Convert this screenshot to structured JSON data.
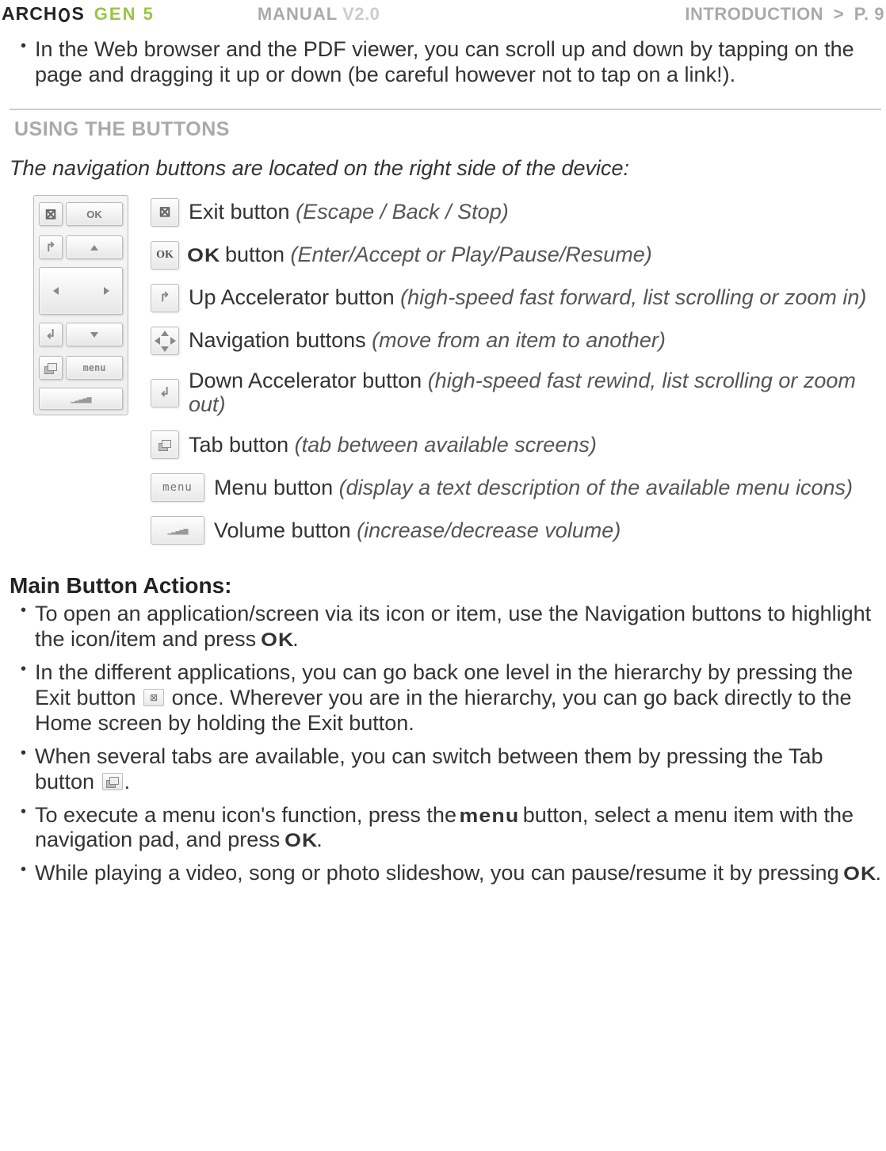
{
  "header": {
    "brand": "ARCHOS",
    "gen": "GEN 5",
    "manual_label": "MANUAL",
    "manual_version": "V2.0",
    "breadcrumb_section": "INTRODUCTION",
    "breadcrumb_sep": ">",
    "breadcrumb_page": "P. 9"
  },
  "top_bullets": [
    "In the Web browser and the PDF viewer, you can scroll up and down by tapping on the page and dragging it up or down (be careful however not to tap on a link!)."
  ],
  "section": {
    "title": "USING THE BUTTONS",
    "intro": "The navigation buttons are located on the right side of the device:"
  },
  "buttons": {
    "exit": {
      "label": "Exit button",
      "desc": "(Escape / Back / Stop)",
      "icon": "close-icon"
    },
    "ok": {
      "label_prefix_heavy": "OK",
      "label_suffix": " button",
      "desc": "(Enter/Accept or Play/Pause/Resume)",
      "icon_text": "OK",
      "icon": "ok-icon"
    },
    "up": {
      "label": "Up Accelerator button",
      "desc": "(high-speed fast forward, list scrolling or zoom in)",
      "icon": "accel-up-icon"
    },
    "nav": {
      "label": "Navigation buttons",
      "desc": "(move from an item to another)",
      "icon": "nav-cross-icon"
    },
    "down": {
      "label": "Down Accelerator button",
      "desc": "(high-speed fast rewind, list scrolling or zoom out)",
      "icon": "accel-down-icon"
    },
    "tab": {
      "label": "Tab button",
      "desc": "(tab between available screens)",
      "icon": "tab-icon"
    },
    "menu": {
      "label": "Menu button",
      "desc": "(display a text description of the available menu icons)",
      "icon_text": "menu",
      "icon": "menu-icon"
    },
    "vol": {
      "label": "Volume button",
      "desc": "(increase/decrease volume)",
      "icon": "volume-icon"
    }
  },
  "main_actions_heading": "Main Button Actions:",
  "main_actions": {
    "items": [
      {
        "pre": "To open an application/screen via its icon or item, use the Navigation buttons to highlight the icon/item and press ",
        "heavy": "OK",
        "post": "."
      },
      {
        "pre": "In the different applications, you can go back one level in the hierarchy by pressing the Exit button ",
        "inline_icon": "close-icon",
        "post": " once. Wherever you are in the hierarchy, you can go back directly to the Home screen by holding the Exit button."
      },
      {
        "pre": "When several tabs are available, you can switch between them by pressing the Tab button ",
        "inline_icon": "tab-icon",
        "post": "."
      },
      {
        "pre": "To execute a menu icon's function, press the ",
        "heavy": "menu",
        "mid": " button, select a menu item with the navigation pad, and press ",
        "heavy2": "OK",
        "post": "."
      },
      {
        "pre": "While playing a video, song or photo slideshow, you can pause/resume it by pressing ",
        "heavy": "OK",
        "post": "."
      }
    ]
  },
  "device_panel": {
    "ok_text": "OK",
    "menu_text": "menu"
  }
}
